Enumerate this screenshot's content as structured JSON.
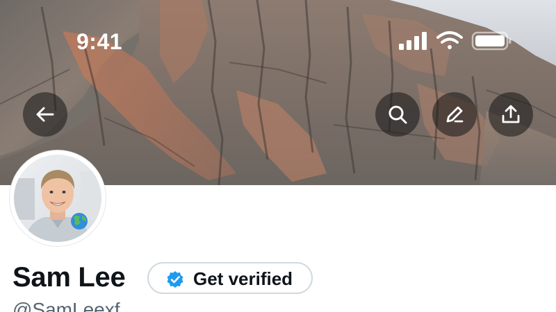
{
  "status_bar": {
    "time": "9:41",
    "icons": [
      "cellular-signal-icon",
      "wifi-icon",
      "battery-icon"
    ]
  },
  "header_actions": {
    "back_icon": "arrow-left-icon",
    "search_icon": "search-icon",
    "edit_icon": "pencil-icon",
    "share_icon": "share-upload-icon"
  },
  "profile": {
    "display_name": "Sam Lee",
    "get_verified_label": "Get verified",
    "handle": "@SamLeexf",
    "badge_icon": "verified-badge-icon",
    "avatar_emoji_icon": "globe-emoji-icon"
  },
  "colors": {
    "verified_blue": "#1d9bf0",
    "text_primary": "#0f1419",
    "text_secondary": "#536471",
    "button_border": "#cfd9de"
  }
}
